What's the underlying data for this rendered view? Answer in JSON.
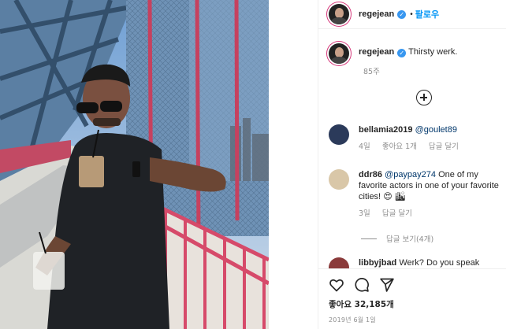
{
  "header": {
    "username": "regejean",
    "dot": "•",
    "follow_label": "팔로우"
  },
  "caption": {
    "username": "regejean",
    "text": "Thirsty werk.",
    "age": "85주"
  },
  "comments": [
    {
      "username": "bellamia2019",
      "mention": "@goulet89",
      "text": "",
      "age": "4일",
      "likes": "좋아요 1개",
      "reply": "답글 달기"
    },
    {
      "username": "ddr86",
      "mention": "@paypay274",
      "text": " One of my favorite actors in one of your favorite cities!",
      "emoji": "😍 🏙",
      "age": "3일",
      "reply": "답글 달기"
    },
    {
      "username": "libbyjbad",
      "text": " Werk? Do you speak"
    }
  ],
  "replies_label": "답글 보기(4개)",
  "actions": {
    "like_icon": "heart-icon",
    "comment_icon": "comment-icon",
    "share_icon": "share-icon"
  },
  "likes_count": "좋아요 32,185개",
  "post_date": "2019년 6월 1일",
  "colors": {
    "accent": "#0095f6",
    "bridge": "#d64a6a",
    "sky": "#7ea9d6"
  }
}
